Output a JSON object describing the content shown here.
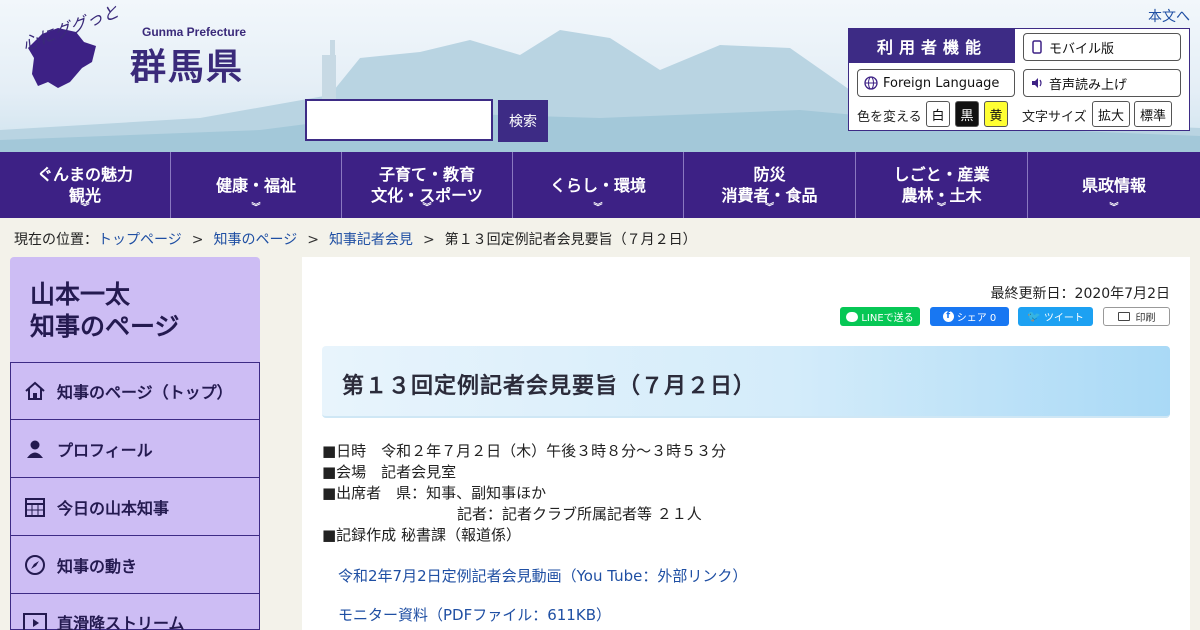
{
  "header": {
    "logo_catch": "心にググっと",
    "logo_en": "Gunma Prefecture",
    "logo_jp": "群馬県",
    "skip_link": "本文へ",
    "search_button": "検索"
  },
  "utility": {
    "title": "利用者機能",
    "mobile": "モバイル版",
    "foreign": "Foreign Language",
    "voice": "音声読み上げ",
    "color_label": "色を変える",
    "color_white": "白",
    "color_black": "黒",
    "color_yellow": "黄",
    "size_label": "文字サイズ",
    "size_large": "拡大",
    "size_normal": "標準"
  },
  "nav": [
    {
      "line1": "ぐんまの魅力",
      "line2": "観光"
    },
    {
      "line1": "健康・福祉",
      "line2": ""
    },
    {
      "line1": "子育て・教育",
      "line2": "文化・スポーツ"
    },
    {
      "line1": "くらし・環境",
      "line2": ""
    },
    {
      "line1": "防災",
      "line2": "消費者・食品"
    },
    {
      "line1": "しごと・産業",
      "line2": "農林・土木"
    },
    {
      "line1": "県政情報",
      "line2": ""
    }
  ],
  "breadcrumb": {
    "label": "現在の位置：",
    "items": [
      "トップページ",
      "知事のページ",
      "知事記者会見"
    ],
    "current": "第１３回定例記者会見要旨（７月２日）",
    "sep": ">"
  },
  "sidebar": {
    "title": "山本一太\n知事のページ",
    "items": [
      {
        "label": "知事のページ（トップ）",
        "icon": "home-icon"
      },
      {
        "label": "プロフィール",
        "icon": "person-icon"
      },
      {
        "label": "今日の山本知事",
        "icon": "calendar-icon"
      },
      {
        "label": "知事の動き",
        "icon": "compass-icon"
      },
      {
        "label": "直滑降ストリーム",
        "icon": "video-icon"
      }
    ]
  },
  "main": {
    "updated": "最終更新日：2020年7月2日",
    "share": {
      "line": "LINEで送る",
      "facebook": "シェア 0",
      "twitter": "ツイート",
      "print": "印刷"
    },
    "title": "第１３回定例記者会見要旨（７月２日）",
    "body_lines": [
      "■日時　令和２年７月２日（木）午後３時８分～３時５３分",
      "■会場　記者会見室",
      "■出席者　県：知事、副知事ほか",
      "　　　　　　　　　記者：記者クラブ所属記者等 ２１人",
      "■記録作成 秘書課（報道係）"
    ],
    "link_video": "令和2年7月2日定例記者会見動画（You Tube：外部リンク）",
    "link_pdf": "モニター資料（PDFファイル：611KB）"
  },
  "colors": {
    "brand": "#3d2185",
    "link": "#1f4fa3",
    "sidebar": "#cdbdf4"
  }
}
